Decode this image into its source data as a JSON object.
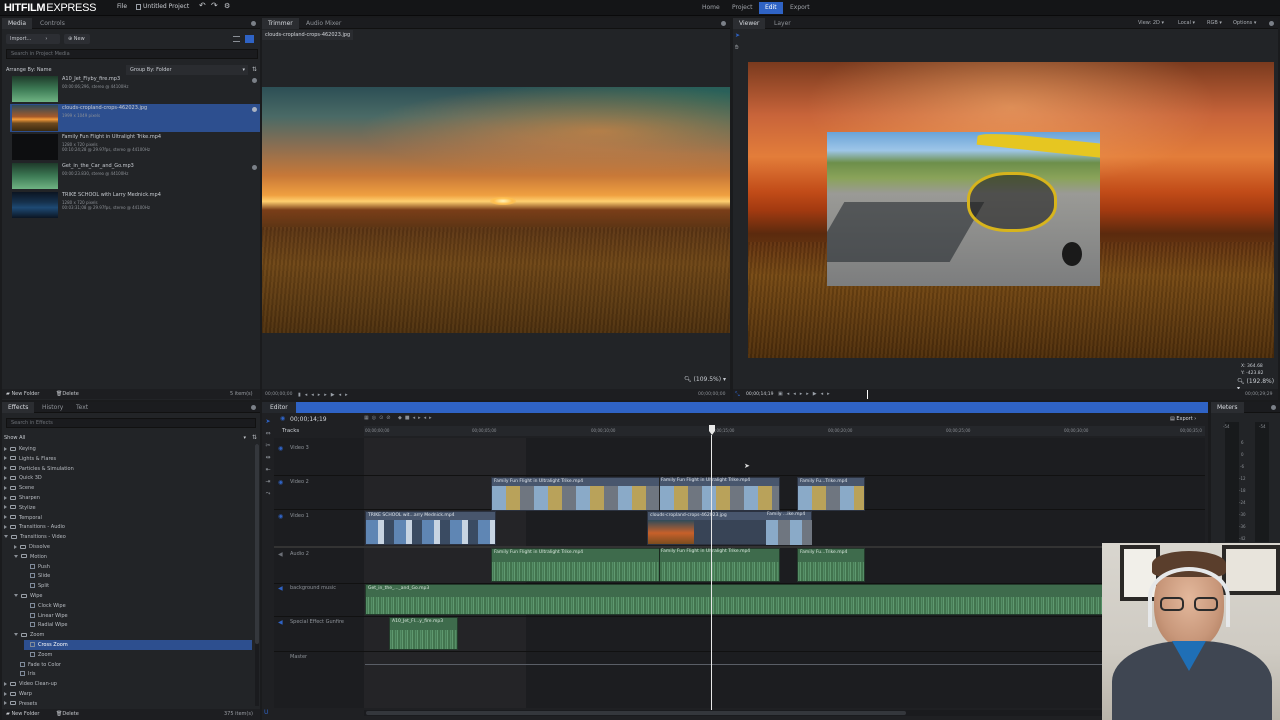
{
  "app": {
    "logo_main": "HITFILM",
    "logo_sub": "EXPRESS",
    "menu": [
      "File"
    ],
    "project_title": "Untitled Project",
    "nav_tabs": [
      "Home",
      "Project",
      "Edit",
      "Export"
    ],
    "active_nav": "Edit"
  },
  "media_panel": {
    "tabs": [
      "Media",
      "Controls"
    ],
    "import_label": "Import...",
    "new_label": "New",
    "search_placeholder": "Search in Project Media",
    "arrange_label": "Arrange By: Name",
    "group_label": "Group By: Folder",
    "items": [
      {
        "name": "A10_Jet_Flyby_fire.mp3",
        "desc": "00:00:06;296, stereo @ 44100Hz",
        "selected": false
      },
      {
        "name": "clouds-cropland-crops-462023.jpg",
        "desc": "1999 x 1049 pixels",
        "selected": true
      },
      {
        "name": "Family Fun Flight in Ultralight Trike.mp4",
        "desc": "1280 x 720 pixels\n00:10:24;28 @ 29.97fps, stereo @ 44100Hz",
        "selected": false
      },
      {
        "name": "Get_in_the_Car_and_Go.mp3",
        "desc": "00:00:23.830, stereo @ 44100Hz",
        "selected": false
      },
      {
        "name": "TRIKE SCHOOL with Larry Mednick.mp4",
        "desc": "1280 x 720 pixels\n00:03:31;08 @ 29.97fps, stereo @ 44100Hz",
        "selected": false
      }
    ],
    "new_folder_label": "New Folder",
    "delete_label": "Delete",
    "item_count": "5 item(s)"
  },
  "trimmer": {
    "tabs": [
      "Trimmer",
      "Audio Mixer"
    ],
    "file_label": "clouds-cropland-crops-462023.jpg",
    "timecode_left": "00;00;00;00",
    "timecode_right": "00;00;00;00",
    "zoom": "(109.5%)"
  },
  "viewer": {
    "tabs": [
      "Viewer",
      "Layer"
    ],
    "view_options": [
      "View: 2D",
      "Local",
      "RGB",
      "Options"
    ],
    "timecode_left": "00;00;14;19",
    "timecode_right": "00;00;29;29",
    "x_label": "X:",
    "x_value": "364.68",
    "y_label": "Y:",
    "y_value": "-423.82",
    "zoom": "(192.8%)"
  },
  "effects_panel": {
    "tabs": [
      "Effects",
      "History",
      "Text"
    ],
    "search_placeholder": "Search in Effects",
    "show_label": "Show All",
    "tree": [
      {
        "label": "Keying",
        "indent": 0,
        "type": "folder",
        "open": false
      },
      {
        "label": "Lights & Flares",
        "indent": 0,
        "type": "folder",
        "open": false
      },
      {
        "label": "Particles & Simulation",
        "indent": 0,
        "type": "folder",
        "open": false
      },
      {
        "label": "Quick 3D",
        "indent": 0,
        "type": "folder",
        "open": false
      },
      {
        "label": "Scene",
        "indent": 0,
        "type": "folder",
        "open": false
      },
      {
        "label": "Sharpen",
        "indent": 0,
        "type": "folder",
        "open": false
      },
      {
        "label": "Stylize",
        "indent": 0,
        "type": "folder",
        "open": false
      },
      {
        "label": "Temporal",
        "indent": 0,
        "type": "folder",
        "open": false
      },
      {
        "label": "Transitions - Audio",
        "indent": 0,
        "type": "folder",
        "open": false
      },
      {
        "label": "Transitions - Video",
        "indent": 0,
        "type": "folder",
        "open": true
      },
      {
        "label": "Dissolve",
        "indent": 1,
        "type": "folder",
        "open": false
      },
      {
        "label": "Motion",
        "indent": 1,
        "type": "folder",
        "open": true
      },
      {
        "label": "Push",
        "indent": 2,
        "type": "effect",
        "open": false
      },
      {
        "label": "Slide",
        "indent": 2,
        "type": "effect",
        "open": false
      },
      {
        "label": "Split",
        "indent": 2,
        "type": "effect",
        "open": false
      },
      {
        "label": "Wipe",
        "indent": 1,
        "type": "folder",
        "open": true
      },
      {
        "label": "Clock Wipe",
        "indent": 2,
        "type": "effect",
        "open": false
      },
      {
        "label": "Linear Wipe",
        "indent": 2,
        "type": "effect",
        "open": false
      },
      {
        "label": "Radial Wipe",
        "indent": 2,
        "type": "effect",
        "open": false
      },
      {
        "label": "Zoom",
        "indent": 1,
        "type": "folder",
        "open": true
      },
      {
        "label": "Cross Zoom",
        "indent": 2,
        "type": "effect",
        "open": false,
        "selected": true
      },
      {
        "label": "Zoom",
        "indent": 2,
        "type": "effect",
        "open": false
      },
      {
        "label": "Fade to Color",
        "indent": 1,
        "type": "effect",
        "open": false
      },
      {
        "label": "Iris",
        "indent": 1,
        "type": "effect",
        "open": false
      },
      {
        "label": "Video Clean-up",
        "indent": 0,
        "type": "folder",
        "open": false
      },
      {
        "label": "Warp",
        "indent": 0,
        "type": "folder",
        "open": false
      },
      {
        "label": "Presets",
        "indent": 0,
        "type": "folder",
        "open": false
      }
    ],
    "new_folder_label": "New Folder",
    "delete_label": "Delete",
    "item_count": "375 item(s)"
  },
  "editor": {
    "tab": "Editor",
    "timecode": "00;00;14;19",
    "tracks_label": "Tracks",
    "export_label": "Export",
    "ruler_labels": [
      "00;00;00;00",
      "00;00;05;00",
      "00;00;10;00",
      "00;00;15;00",
      "00;00;20;00",
      "00;00;25;00",
      "00;00;30;00",
      "00;00;35;0"
    ],
    "tracks": [
      "Video 3",
      "Video 2",
      "Video 1",
      "Audio 2",
      "background music",
      "Special Effect Gunfire",
      "Master"
    ],
    "clips": {
      "v2a": "Family Fun Flight in Ultralight Trike.mp4",
      "v2b": "Family Fun Flight in Ultralight Trike.mp4",
      "v2c": "Family Fu...Trike.mp4",
      "v1a": "TRIKE SCHOOL wit...arry Mednick.mp4",
      "v1b": "clouds-cropland-crops-462023.jpg",
      "v1c": "Family ...ike.mp4",
      "a2a": "Family Fun Flight in Ultralight Trike.mp4",
      "a2b": "Family Fun Flight in Ultralight Trike.mp4",
      "a2c": "Family Fu...Trike.mp4",
      "bg": "Get_in_the_..._and_Go.mp3",
      "sfx": "A10_Jet_Fl...y_fire.mp3"
    }
  },
  "meters": {
    "tab": "Meters",
    "top_left": "-54",
    "top_right": "-54",
    "scale": [
      "6",
      "0",
      "-6",
      "-12",
      "-18",
      "-24",
      "-30",
      "-36",
      "-42",
      "-48"
    ]
  },
  "colors": {
    "accent": "#2f63c5",
    "selection": "#2d4f8f",
    "video_clip": "#5a6b85",
    "audio_clip": "#3e6b4c"
  }
}
